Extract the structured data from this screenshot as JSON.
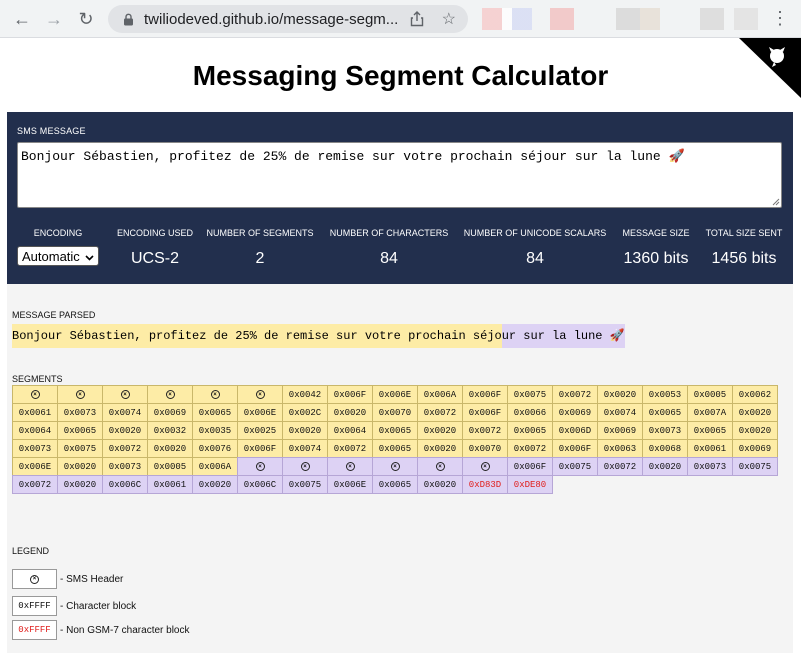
{
  "browser": {
    "url": "twiliodeved.github.io/message-segm..."
  },
  "page": {
    "title": "Messaging Segment Calculator"
  },
  "sms": {
    "label": "SMS MESSAGE",
    "message": "Bonjour Sébastien, profitez de 25% de remise sur votre prochain séjour sur la lune 🚀"
  },
  "stats": {
    "encoding_label": "ENCODING",
    "encoding_value": "Automatic",
    "encoding_used_label": "ENCODING USED",
    "encoding_used_value": "UCS-2",
    "segments_label": "NUMBER OF SEGMENTS",
    "segments_value": "2",
    "characters_label": "NUMBER OF CHARACTERS",
    "characters_value": "84",
    "scalars_label": "NUMBER OF UNICODE SCALARS",
    "scalars_value": "84",
    "size_label": "MESSAGE SIZE",
    "size_value": "1360 bits",
    "total_label": "TOTAL SIZE SENT",
    "total_value": "1456 bits"
  },
  "parsed": {
    "label": "MESSAGE PARSED",
    "segment1": "Bonjour Sébastien, profitez de 25% de remise sur votre prochain séjo",
    "segment2": "ur sur la lune 🚀"
  },
  "segments": {
    "label": "SEGMENTS",
    "header_glyph": "⊗",
    "cells": [
      {
        "v": "H",
        "s": 1
      },
      {
        "v": "H",
        "s": 1
      },
      {
        "v": "H",
        "s": 1
      },
      {
        "v": "H",
        "s": 1
      },
      {
        "v": "H",
        "s": 1
      },
      {
        "v": "H",
        "s": 1
      },
      {
        "v": "0x0042",
        "s": 1
      },
      {
        "v": "0x006F",
        "s": 1
      },
      {
        "v": "0x006E",
        "s": 1
      },
      {
        "v": "0x006A",
        "s": 1
      },
      {
        "v": "0x006F",
        "s": 1
      },
      {
        "v": "0x0075",
        "s": 1
      },
      {
        "v": "0x0072",
        "s": 1
      },
      {
        "v": "0x0020",
        "s": 1
      },
      {
        "v": "0x0053",
        "s": 1
      },
      {
        "v": "0x0005",
        "s": 1
      },
      {
        "v": "0x0062",
        "s": 1
      },
      {
        "v": "0x0061",
        "s": 1
      },
      {
        "v": "0x0073",
        "s": 1
      },
      {
        "v": "0x0074",
        "s": 1
      },
      {
        "v": "0x0069",
        "s": 1
      },
      {
        "v": "0x0065",
        "s": 1
      },
      {
        "v": "0x006E",
        "s": 1
      },
      {
        "v": "0x002C",
        "s": 1
      },
      {
        "v": "0x0020",
        "s": 1
      },
      {
        "v": "0x0070",
        "s": 1
      },
      {
        "v": "0x0072",
        "s": 1
      },
      {
        "v": "0x006F",
        "s": 1
      },
      {
        "v": "0x0066",
        "s": 1
      },
      {
        "v": "0x0069",
        "s": 1
      },
      {
        "v": "0x0074",
        "s": 1
      },
      {
        "v": "0x0065",
        "s": 1
      },
      {
        "v": "0x007A",
        "s": 1
      },
      {
        "v": "0x0020",
        "s": 1
      },
      {
        "v": "0x0064",
        "s": 1
      },
      {
        "v": "0x0065",
        "s": 1
      },
      {
        "v": "0x0020",
        "s": 1
      },
      {
        "v": "0x0032",
        "s": 1
      },
      {
        "v": "0x0035",
        "s": 1
      },
      {
        "v": "0x0025",
        "s": 1
      },
      {
        "v": "0x0020",
        "s": 1
      },
      {
        "v": "0x0064",
        "s": 1
      },
      {
        "v": "0x0065",
        "s": 1
      },
      {
        "v": "0x0020",
        "s": 1
      },
      {
        "v": "0x0072",
        "s": 1
      },
      {
        "v": "0x0065",
        "s": 1
      },
      {
        "v": "0x006D",
        "s": 1
      },
      {
        "v": "0x0069",
        "s": 1
      },
      {
        "v": "0x0073",
        "s": 1
      },
      {
        "v": "0x0065",
        "s": 1
      },
      {
        "v": "0x0020",
        "s": 1
      },
      {
        "v": "0x0073",
        "s": 1
      },
      {
        "v": "0x0075",
        "s": 1
      },
      {
        "v": "0x0072",
        "s": 1
      },
      {
        "v": "0x0020",
        "s": 1
      },
      {
        "v": "0x0076",
        "s": 1
      },
      {
        "v": "0x006F",
        "s": 1
      },
      {
        "v": "0x0074",
        "s": 1
      },
      {
        "v": "0x0072",
        "s": 1
      },
      {
        "v": "0x0065",
        "s": 1
      },
      {
        "v": "0x0020",
        "s": 1
      },
      {
        "v": "0x0070",
        "s": 1
      },
      {
        "v": "0x0072",
        "s": 1
      },
      {
        "v": "0x006F",
        "s": 1
      },
      {
        "v": "0x0063",
        "s": 1
      },
      {
        "v": "0x0068",
        "s": 1
      },
      {
        "v": "0x0061",
        "s": 1
      },
      {
        "v": "0x0069",
        "s": 1
      },
      {
        "v": "0x006E",
        "s": 1
      },
      {
        "v": "0x0020",
        "s": 1
      },
      {
        "v": "0x0073",
        "s": 1
      },
      {
        "v": "0x0005",
        "s": 1
      },
      {
        "v": "0x006A",
        "s": 1
      },
      {
        "v": "H",
        "s": 2
      },
      {
        "v": "H",
        "s": 2
      },
      {
        "v": "H",
        "s": 2
      },
      {
        "v": "H",
        "s": 2
      },
      {
        "v": "H",
        "s": 2
      },
      {
        "v": "H",
        "s": 2
      },
      {
        "v": "0x006F",
        "s": 2
      },
      {
        "v": "0x0075",
        "s": 2
      },
      {
        "v": "0x0072",
        "s": 2
      },
      {
        "v": "0x0020",
        "s": 2
      },
      {
        "v": "0x0073",
        "s": 2
      },
      {
        "v": "0x0075",
        "s": 2
      },
      {
        "v": "0x0072",
        "s": 2
      },
      {
        "v": "0x0020",
        "s": 2
      },
      {
        "v": "0x006C",
        "s": 2
      },
      {
        "v": "0x0061",
        "s": 2
      },
      {
        "v": "0x0020",
        "s": 2
      },
      {
        "v": "0x006C",
        "s": 2
      },
      {
        "v": "0x0075",
        "s": 2
      },
      {
        "v": "0x006E",
        "s": 2
      },
      {
        "v": "0x0065",
        "s": 2
      },
      {
        "v": "0x0020",
        "s": 2
      },
      {
        "v": "0xD83D",
        "s": 2,
        "red": true
      },
      {
        "v": "0xDE80",
        "s": 2,
        "red": true
      }
    ]
  },
  "legend": {
    "label": "LEGEND",
    "header_glyph": "⊗",
    "header_text": "- SMS Header",
    "char_box": "0xFFFF",
    "char_text": "- Character block",
    "nongsm_box": "0xFFFF",
    "nongsm_text": "- Non GSM-7 character block"
  },
  "colors": {
    "panel_bg": "#222f4d",
    "segment1": "#fdeca6",
    "segment2": "#ddd2f4",
    "non_gsm": "#e0201e"
  }
}
